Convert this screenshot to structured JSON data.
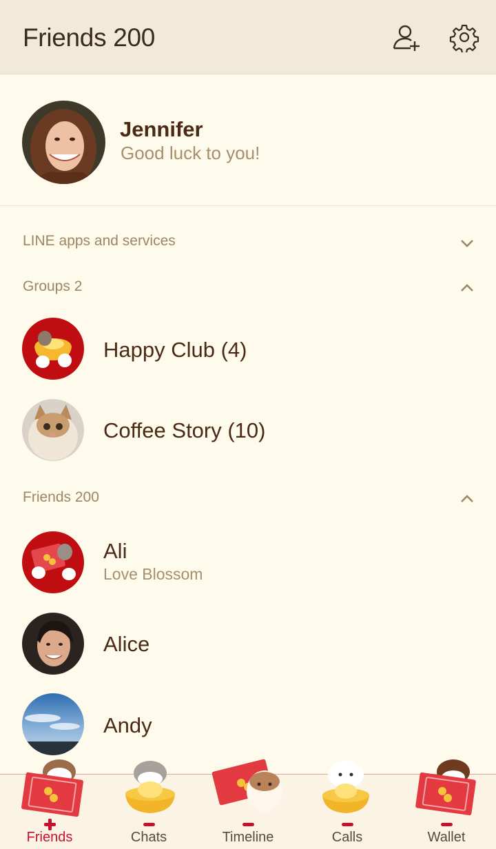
{
  "header": {
    "title": "Friends 200",
    "add_friend_icon": "add-friend-icon",
    "settings_icon": "gear-icon"
  },
  "profile": {
    "name": "Jennifer",
    "status": "Good luck to you!"
  },
  "sections": {
    "services": {
      "label": "LINE apps and services",
      "expanded": false
    },
    "groups": {
      "label": "Groups 2",
      "expanded": true
    },
    "friends": {
      "label": "Friends 200",
      "expanded": true
    }
  },
  "groups": [
    {
      "name": "Happy Club (4)"
    },
    {
      "name": "Coffee Story (10)"
    }
  ],
  "friends": [
    {
      "name": "Ali",
      "status": "Love Blossom"
    },
    {
      "name": "Alice",
      "status": ""
    },
    {
      "name": "Andy",
      "status": ""
    }
  ],
  "tabs": [
    {
      "label": "Friends",
      "active": true
    },
    {
      "label": "Chats",
      "active": false
    },
    {
      "label": "Timeline",
      "active": false
    },
    {
      "label": "Calls",
      "active": false
    },
    {
      "label": "Wallet",
      "active": false
    }
  ],
  "colors": {
    "accent": "#c8102e",
    "header_bg": "#f1eadb",
    "page_bg": "#fefaec",
    "text_dark": "#4a2a14",
    "text_muted": "#a58f6c"
  }
}
